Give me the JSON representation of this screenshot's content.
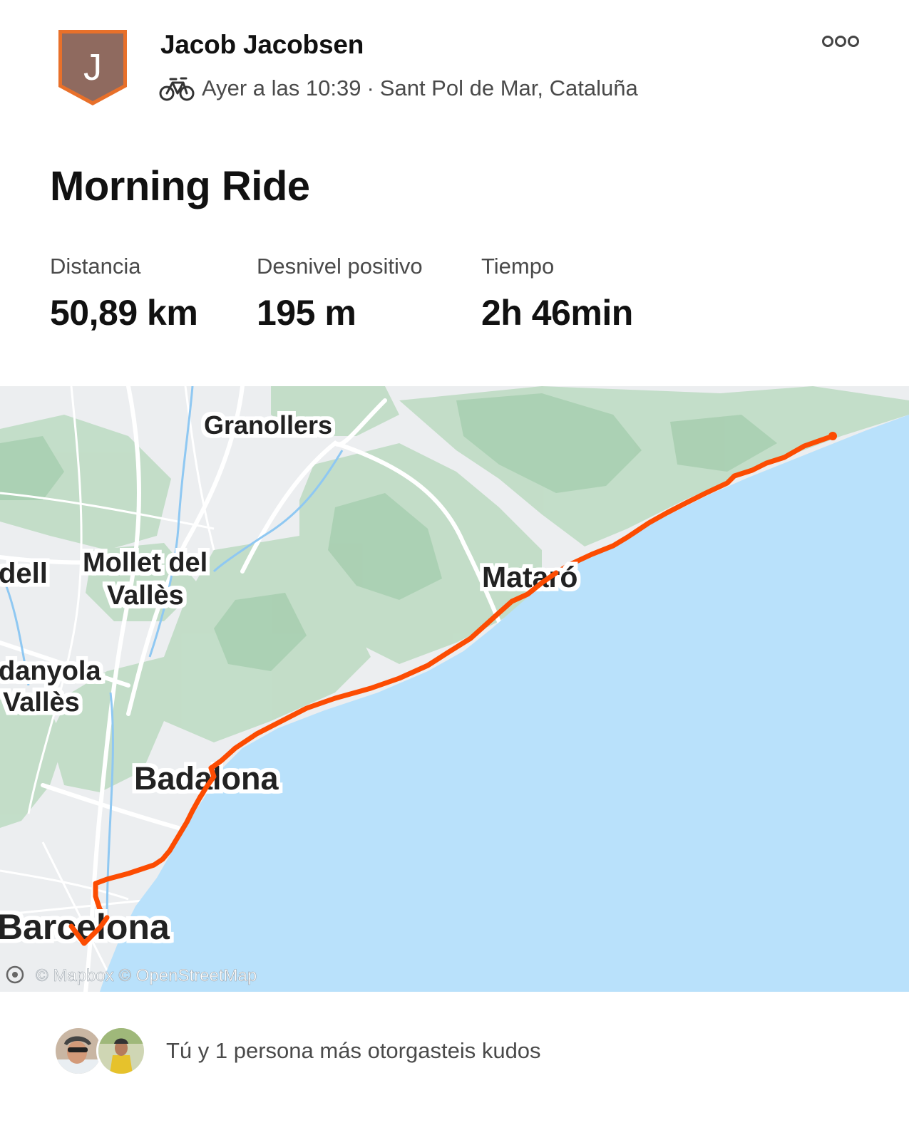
{
  "activity": {
    "athlete_name": "Jacob Jacobsen",
    "avatar_initial": "J",
    "activity_icon": "bike-icon",
    "timestamp": "Ayer a las 10:39",
    "separator": "·",
    "location": "Sant Pol de Mar, Cataluña",
    "title": "Morning Ride",
    "more_icon": "more-options-icon"
  },
  "stats": [
    {
      "label": "Distancia",
      "value": "50,89 km"
    },
    {
      "label": "Desnivel positivo",
      "value": "195 m"
    },
    {
      "label": "Tiempo",
      "value": "2h 46min"
    }
  ],
  "map": {
    "labels": {
      "granollers": "Granollers",
      "mollet_1": "Mollet del",
      "mollet_2": "Vallès",
      "sabadell": "dell",
      "cerdanyola_1": "danyola",
      "cerdanyola_2": "Vallès",
      "mataro": "Mataró",
      "badalona": "Badalona",
      "barcelona": "Barcelona"
    },
    "attribution": "© Mapbox © OpenStreetMap",
    "route_color": "#fc4c02",
    "sea_color": "#b9e1fb"
  },
  "kudos": {
    "text": "Tú y 1 persona más otorgasteis kudos",
    "avatars": [
      "kudos-avatar-1",
      "kudos-avatar-2"
    ]
  }
}
